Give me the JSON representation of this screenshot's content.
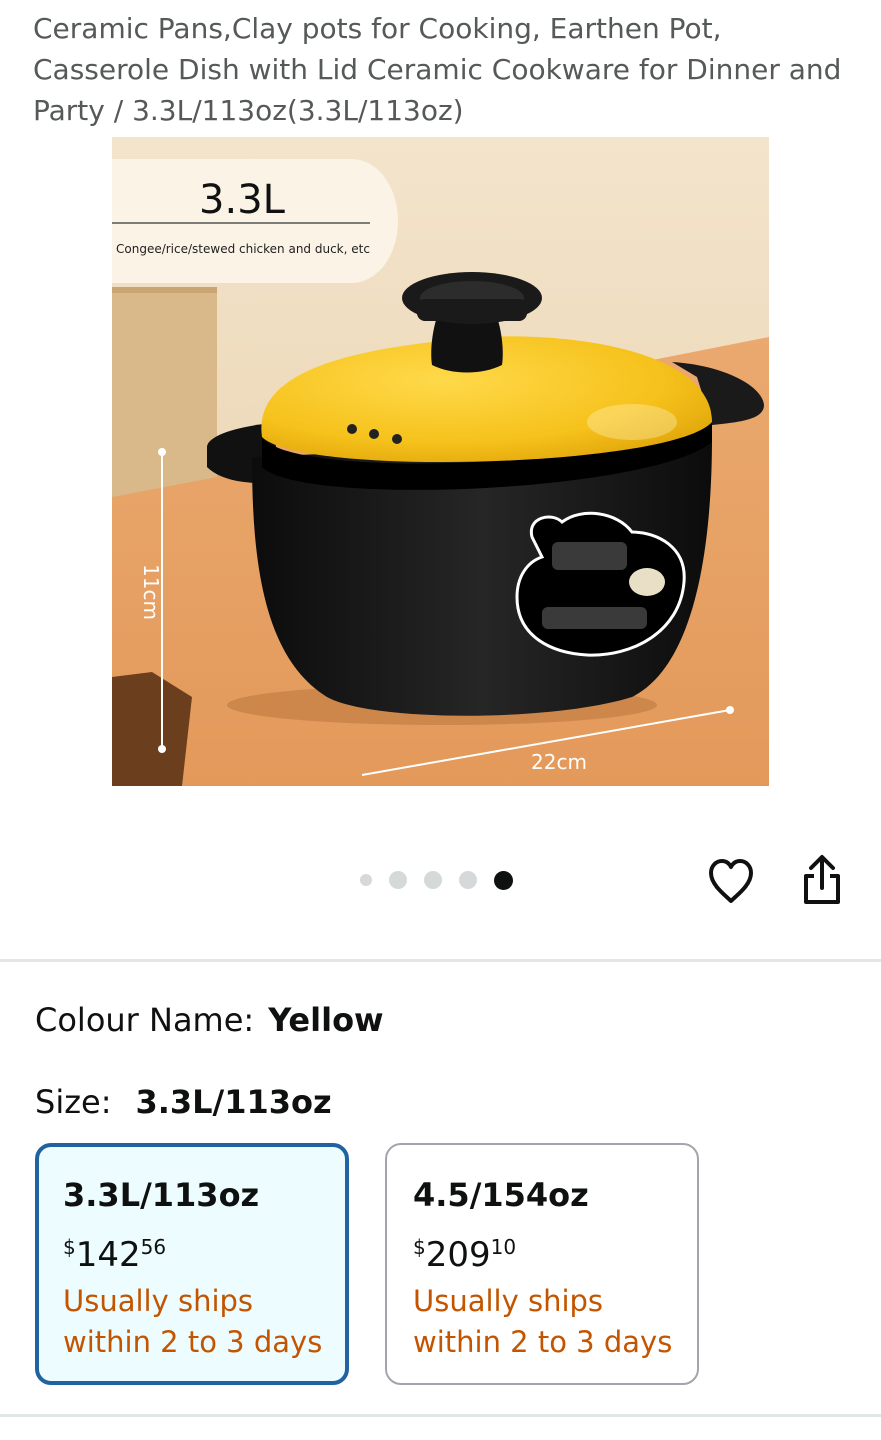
{
  "product": {
    "title": "Ceramic Pans,Clay pots for Cooking, Earthen Pot, Casserole Dish with Lid Ceramic Cookware for Dinner and Party / 3.3L/113oz(3.3L/113oz)",
    "image": {
      "capacity_label": "3.3L",
      "capacity_caption": "Congee/rice/stewed chicken and duck, etc",
      "height_label": "11cm",
      "width_label": "22cm"
    }
  },
  "carousel": {
    "dot_count": 5,
    "active_index": 4
  },
  "actions": {
    "icons": [
      "heart-icon",
      "share-icon"
    ]
  },
  "colour": {
    "label": "Colour Name:",
    "value": "Yellow"
  },
  "size": {
    "label": "Size:",
    "value": "3.3L/113oz",
    "options": [
      {
        "name": "3.3L/113oz",
        "currency": "$",
        "price_whole": "142",
        "price_fraction": "56",
        "ships_line1": "Usually ships",
        "ships_line2": "within 2 to 3 days",
        "selected": true
      },
      {
        "name": "4.5/154oz",
        "currency": "$",
        "price_whole": "209",
        "price_fraction": "10",
        "ships_line1": "Usually ships",
        "ships_line2": "within 2 to 3 days",
        "selected": false
      }
    ]
  },
  "colors": {
    "selected_border": "#2162a1",
    "selected_background": "#edfdff",
    "ships_text": "#c45500",
    "pot_lid": "#f6c21c",
    "pot_body": "#141414",
    "background_wall": "#efdcc0",
    "background_table": "#e8a66b"
  }
}
